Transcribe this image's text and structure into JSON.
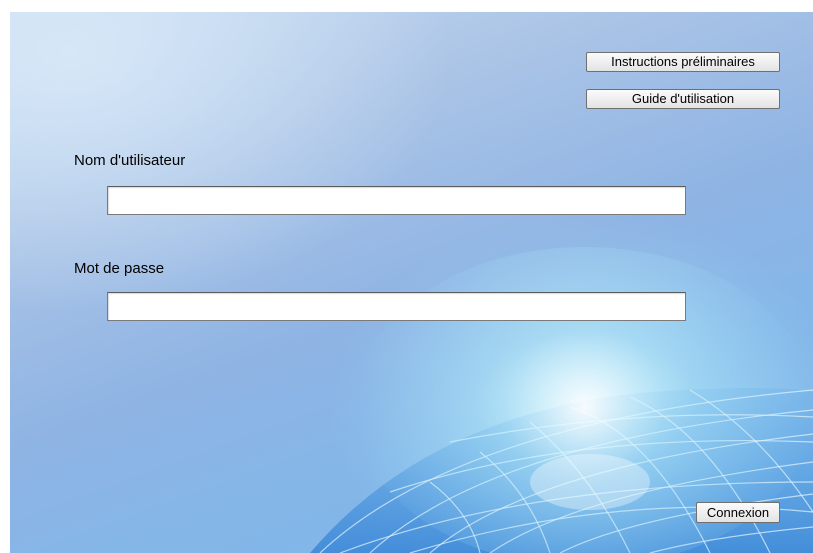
{
  "header": {
    "instructions_label": "Instructions préliminaires",
    "guide_label": "Guide d'utilisation"
  },
  "form": {
    "username_label": "Nom d'utilisateur",
    "username_value": "",
    "password_label": "Mot de passe",
    "password_value": "",
    "submit_label": "Connexion"
  },
  "colors": {
    "background_light": "#c9dcf0",
    "background_mid": "#8fb4e4",
    "background_deep": "#7fb9ea",
    "globe_lines": "#e6f6ff"
  },
  "decor": {
    "background_icon": "globe-grid-icon"
  }
}
